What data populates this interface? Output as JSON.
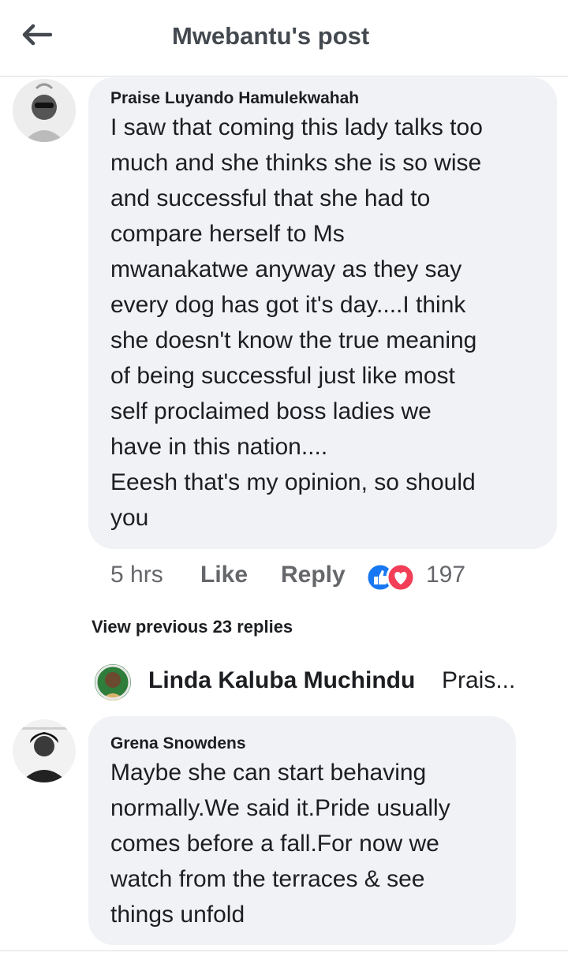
{
  "header": {
    "title": "Mwebantu's post",
    "back_icon": "back-arrow-icon"
  },
  "comments": [
    {
      "author": "Praise Luyando Hamulekwahah",
      "lines": [
        "I saw that coming this lady talks too",
        "much and she thinks she is so wise",
        "and successful that she had to",
        "compare herself  to Ms",
        "mwanakatwe  anyway as they say",
        "every dog has got it's day....I think",
        "she doesn't know the true meaning",
        "of being successful  just like most",
        "self proclaimed boss ladies we",
        "have in this nation....",
        "Eeesh that's my opinion, so should",
        "you"
      ],
      "time": "5 hrs",
      "like_label": "Like",
      "reply_label": "Reply",
      "reaction_count": "197",
      "reactions": [
        "like-reaction-icon",
        "love-reaction-icon"
      ]
    },
    {
      "author": "Grena Snowdens",
      "lines": [
        "Maybe she can start behaving",
        "normally.We said it.Pride usually",
        "comes before a fall.For now we",
        "watch from the terraces & see",
        "things unfold"
      ]
    }
  ],
  "replies": {
    "view_previous": "View previous 23 replies",
    "preview_author": "Linda Kaluba Muchindu",
    "preview_snippet": "Prais..."
  },
  "colors": {
    "bubble": "#f0f2f5",
    "like_blue": "#1877f2",
    "love_red": "#f33e58",
    "meta_gray": "#65676b"
  }
}
